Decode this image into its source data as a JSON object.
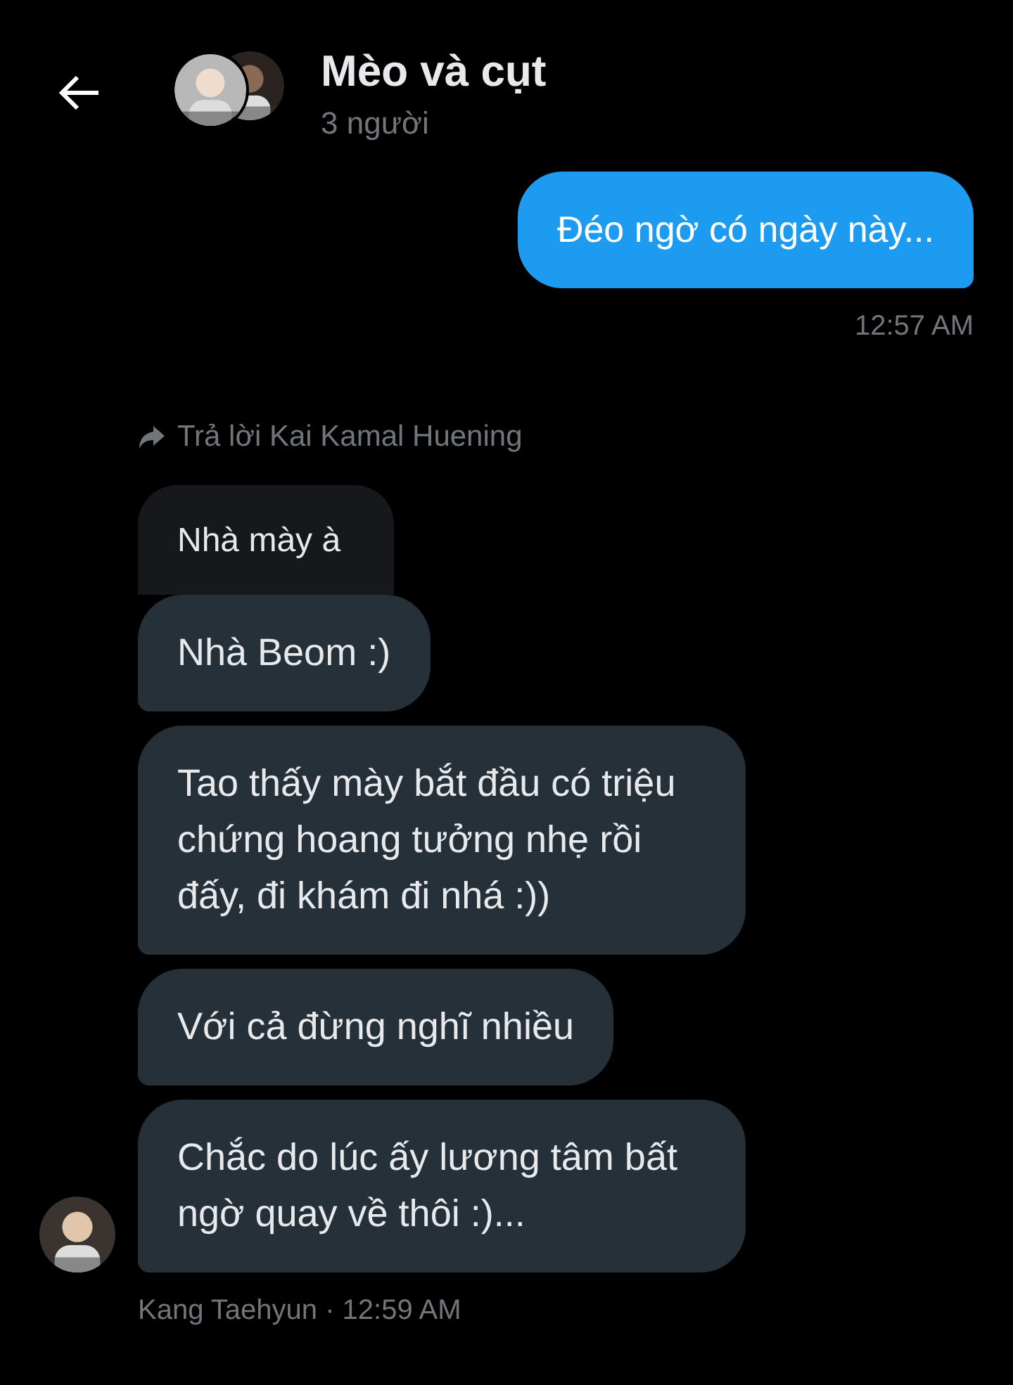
{
  "header": {
    "title": "Mèo và cụt",
    "subtitle": "3 người"
  },
  "messages": [
    {
      "kind": "sent",
      "text": "Đéo ngờ có ngày này...",
      "time": "12:57 AM"
    },
    {
      "kind": "reply_label",
      "text": "Trả lời Kai Kamal Huening"
    },
    {
      "kind": "quoted",
      "text": "Nhà mày à"
    },
    {
      "kind": "received",
      "text": "Nhà Beom :)"
    },
    {
      "kind": "received",
      "text": "Tao thấy mày bắt đầu có triệu chứng hoang tưởng nhẹ rồi đấy, đi khám đi nhá :))"
    },
    {
      "kind": "received",
      "text": "Với cả đừng nghĩ nhiều"
    },
    {
      "kind": "received",
      "text": "Chắc do lúc ấy lương tâm bất ngờ quay về thôi :)...",
      "avatar": true
    }
  ],
  "footer": {
    "text": "Kang Taehyun · 12:59 AM"
  }
}
